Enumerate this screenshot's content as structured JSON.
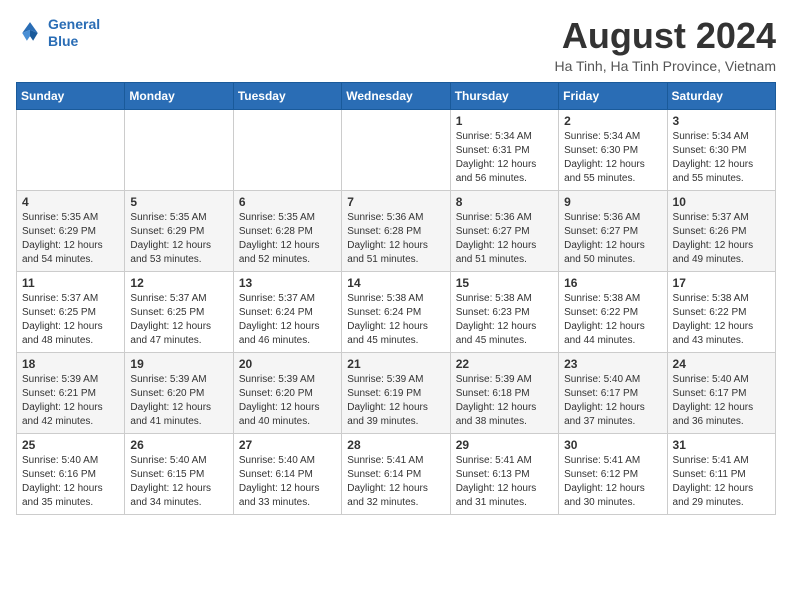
{
  "header": {
    "logo_line1": "General",
    "logo_line2": "Blue",
    "month_year": "August 2024",
    "location": "Ha Tinh, Ha Tinh Province, Vietnam"
  },
  "weekdays": [
    "Sunday",
    "Monday",
    "Tuesday",
    "Wednesday",
    "Thursday",
    "Friday",
    "Saturday"
  ],
  "weeks": [
    [
      {
        "day": "",
        "info": ""
      },
      {
        "day": "",
        "info": ""
      },
      {
        "day": "",
        "info": ""
      },
      {
        "day": "",
        "info": ""
      },
      {
        "day": "1",
        "info": "Sunrise: 5:34 AM\nSunset: 6:31 PM\nDaylight: 12 hours\nand 56 minutes."
      },
      {
        "day": "2",
        "info": "Sunrise: 5:34 AM\nSunset: 6:30 PM\nDaylight: 12 hours\nand 55 minutes."
      },
      {
        "day": "3",
        "info": "Sunrise: 5:34 AM\nSunset: 6:30 PM\nDaylight: 12 hours\nand 55 minutes."
      }
    ],
    [
      {
        "day": "4",
        "info": "Sunrise: 5:35 AM\nSunset: 6:29 PM\nDaylight: 12 hours\nand 54 minutes."
      },
      {
        "day": "5",
        "info": "Sunrise: 5:35 AM\nSunset: 6:29 PM\nDaylight: 12 hours\nand 53 minutes."
      },
      {
        "day": "6",
        "info": "Sunrise: 5:35 AM\nSunset: 6:28 PM\nDaylight: 12 hours\nand 52 minutes."
      },
      {
        "day": "7",
        "info": "Sunrise: 5:36 AM\nSunset: 6:28 PM\nDaylight: 12 hours\nand 51 minutes."
      },
      {
        "day": "8",
        "info": "Sunrise: 5:36 AM\nSunset: 6:27 PM\nDaylight: 12 hours\nand 51 minutes."
      },
      {
        "day": "9",
        "info": "Sunrise: 5:36 AM\nSunset: 6:27 PM\nDaylight: 12 hours\nand 50 minutes."
      },
      {
        "day": "10",
        "info": "Sunrise: 5:37 AM\nSunset: 6:26 PM\nDaylight: 12 hours\nand 49 minutes."
      }
    ],
    [
      {
        "day": "11",
        "info": "Sunrise: 5:37 AM\nSunset: 6:25 PM\nDaylight: 12 hours\nand 48 minutes."
      },
      {
        "day": "12",
        "info": "Sunrise: 5:37 AM\nSunset: 6:25 PM\nDaylight: 12 hours\nand 47 minutes."
      },
      {
        "day": "13",
        "info": "Sunrise: 5:37 AM\nSunset: 6:24 PM\nDaylight: 12 hours\nand 46 minutes."
      },
      {
        "day": "14",
        "info": "Sunrise: 5:38 AM\nSunset: 6:24 PM\nDaylight: 12 hours\nand 45 minutes."
      },
      {
        "day": "15",
        "info": "Sunrise: 5:38 AM\nSunset: 6:23 PM\nDaylight: 12 hours\nand 45 minutes."
      },
      {
        "day": "16",
        "info": "Sunrise: 5:38 AM\nSunset: 6:22 PM\nDaylight: 12 hours\nand 44 minutes."
      },
      {
        "day": "17",
        "info": "Sunrise: 5:38 AM\nSunset: 6:22 PM\nDaylight: 12 hours\nand 43 minutes."
      }
    ],
    [
      {
        "day": "18",
        "info": "Sunrise: 5:39 AM\nSunset: 6:21 PM\nDaylight: 12 hours\nand 42 minutes."
      },
      {
        "day": "19",
        "info": "Sunrise: 5:39 AM\nSunset: 6:20 PM\nDaylight: 12 hours\nand 41 minutes."
      },
      {
        "day": "20",
        "info": "Sunrise: 5:39 AM\nSunset: 6:20 PM\nDaylight: 12 hours\nand 40 minutes."
      },
      {
        "day": "21",
        "info": "Sunrise: 5:39 AM\nSunset: 6:19 PM\nDaylight: 12 hours\nand 39 minutes."
      },
      {
        "day": "22",
        "info": "Sunrise: 5:39 AM\nSunset: 6:18 PM\nDaylight: 12 hours\nand 38 minutes."
      },
      {
        "day": "23",
        "info": "Sunrise: 5:40 AM\nSunset: 6:17 PM\nDaylight: 12 hours\nand 37 minutes."
      },
      {
        "day": "24",
        "info": "Sunrise: 5:40 AM\nSunset: 6:17 PM\nDaylight: 12 hours\nand 36 minutes."
      }
    ],
    [
      {
        "day": "25",
        "info": "Sunrise: 5:40 AM\nSunset: 6:16 PM\nDaylight: 12 hours\nand 35 minutes."
      },
      {
        "day": "26",
        "info": "Sunrise: 5:40 AM\nSunset: 6:15 PM\nDaylight: 12 hours\nand 34 minutes."
      },
      {
        "day": "27",
        "info": "Sunrise: 5:40 AM\nSunset: 6:14 PM\nDaylight: 12 hours\nand 33 minutes."
      },
      {
        "day": "28",
        "info": "Sunrise: 5:41 AM\nSunset: 6:14 PM\nDaylight: 12 hours\nand 32 minutes."
      },
      {
        "day": "29",
        "info": "Sunrise: 5:41 AM\nSunset: 6:13 PM\nDaylight: 12 hours\nand 31 minutes."
      },
      {
        "day": "30",
        "info": "Sunrise: 5:41 AM\nSunset: 6:12 PM\nDaylight: 12 hours\nand 30 minutes."
      },
      {
        "day": "31",
        "info": "Sunrise: 5:41 AM\nSunset: 6:11 PM\nDaylight: 12 hours\nand 29 minutes."
      }
    ]
  ]
}
